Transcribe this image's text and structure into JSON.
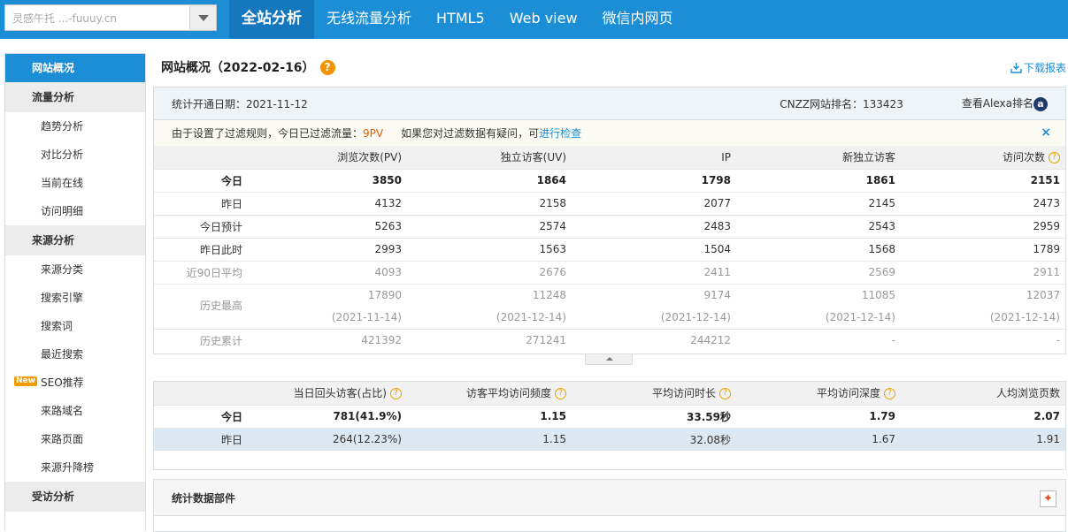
{
  "topbar": {
    "site_selector_value": "灵感午托 ...-fuuuy.cn",
    "tabs": [
      "全站分析",
      "无线流量分析",
      "HTML5",
      "Web view",
      "微信内网页"
    ]
  },
  "sidebar": {
    "active_item": "网站概况",
    "groups": [
      {
        "label": "流量分析",
        "items": [
          "趋势分析",
          "对比分析",
          "当前在线",
          "访问明细"
        ]
      },
      {
        "label": "来源分析",
        "items": [
          "来源分类",
          "搜索引擎",
          "搜索词",
          "最近搜索",
          "SEO推荐",
          "来路域名",
          "来路页面",
          "来源升降榜"
        ]
      },
      {
        "label": "受访分析",
        "items": []
      }
    ],
    "new_badge": "New"
  },
  "page": {
    "title": "网站概况（2022-02-16）",
    "help_icon": "?",
    "download_label": "下载报表"
  },
  "info": {
    "open_date": "统计开通日期：2021-11-12",
    "rank": "CNZZ网站排名：133423",
    "alexa": "查看Alexa排名",
    "alexa_icon": "a"
  },
  "filter": {
    "text1": "由于设置了过滤规则，今日已过滤流量：",
    "pv": "9PV",
    "text2": "如果您对过滤数据有疑问，可",
    "link": "进行检查",
    "close": "×"
  },
  "table1": {
    "headers": [
      "浏览次数(PV)",
      "独立访客(UV)",
      "IP",
      "新独立访客",
      "访问次数"
    ],
    "rows": [
      {
        "label": "今日",
        "values": [
          "3850",
          "1864",
          "1798",
          "1861",
          "2151"
        ]
      },
      {
        "label": "昨日",
        "values": [
          "4132",
          "2158",
          "2077",
          "2145",
          "2473"
        ]
      },
      {
        "label": "今日预计",
        "values": [
          "5263",
          "2574",
          "2483",
          "2543",
          "2959"
        ]
      },
      {
        "label": "昨日此时",
        "values": [
          "2993",
          "1563",
          "1504",
          "1568",
          "1789"
        ]
      },
      {
        "label": "近90日平均",
        "values": [
          "4093",
          "2676",
          "2411",
          "2569",
          "2911"
        ]
      },
      {
        "label": "历史最高",
        "values": [
          "17890",
          "11248",
          "9174",
          "11085",
          "12037"
        ],
        "dates": [
          "(2021-11-14)",
          "(2021-12-14)",
          "(2021-12-14)",
          "(2021-12-14)",
          "(2021-12-14)"
        ]
      },
      {
        "label": "历史累计",
        "values": [
          "421392",
          "271241",
          "244212",
          "-",
          "-"
        ]
      }
    ]
  },
  "table2": {
    "headers": [
      "当日回头访客(占比)",
      "访客平均访问频度",
      "平均访问时长",
      "平均访问深度",
      "人均浏览页数"
    ],
    "rows": [
      {
        "label": "今日",
        "values": [
          "781(41.9%)",
          "1.15",
          "33.59秒",
          "1.79",
          "2.07"
        ]
      },
      {
        "label": "昨日",
        "values": [
          "264(12.23%)",
          "1.15",
          "32.08秒",
          "1.67",
          "1.91"
        ]
      }
    ]
  },
  "widgets": {
    "title": "统计数据部件"
  }
}
